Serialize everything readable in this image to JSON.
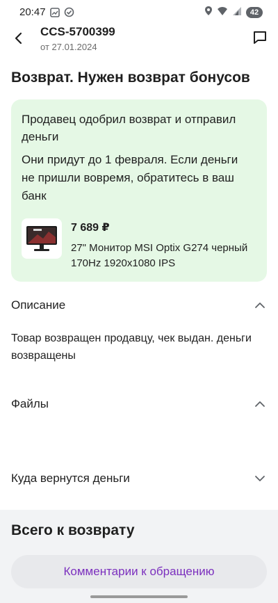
{
  "status_bar": {
    "time": "20:47",
    "battery": "42"
  },
  "header": {
    "title": "CCS-5700399",
    "subtitle": "от 27.01.2024"
  },
  "page_title": "Возврат. Нужен возврат бонусов",
  "status_card": {
    "heading": "Продавец одобрил возврат и отправил деньги",
    "text": "Они придут до 1 февраля. Если деньги не пришли вовремя, обратитесь в ваш банк",
    "bg_color": "#e5f8e5",
    "product": {
      "price": "7 689 ₽",
      "name": "27\" Монитор MSI Optix G274 черный 170Hz 1920x1080 IPS"
    }
  },
  "sections": {
    "description": {
      "label": "Описание",
      "expanded": true,
      "text": "Товар возвращен продавцу, чек выдан. деньги возвращены"
    },
    "files": {
      "label": "Файлы",
      "expanded": true
    },
    "refund_destination": {
      "label": "Куда вернутся деньги",
      "expanded": false
    }
  },
  "bottom": {
    "total_label": "Всего к возврату",
    "comments_button": "Комментарии к обращению",
    "accent_color": "#7b2fbe"
  },
  "icons": {
    "back": "arrow-left-icon",
    "chat": "chat-bubble-icon",
    "collapse": "chevron-up-icon",
    "expand": "chevron-down-icon"
  }
}
